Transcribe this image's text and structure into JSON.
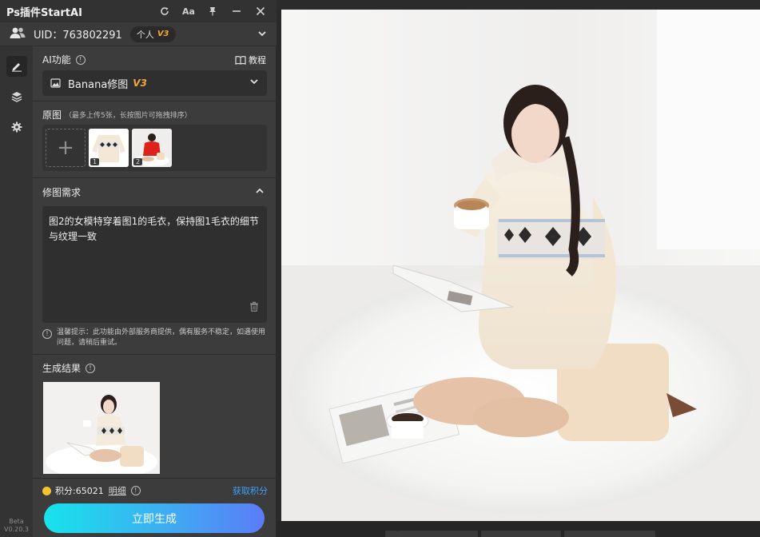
{
  "window": {
    "title": "Ps插件StartAI"
  },
  "user": {
    "uid_label": "UID：763802291",
    "plan_label": "个人",
    "plan_version": "V3"
  },
  "ai_function": {
    "label": "AI功能",
    "tutorial_label": "教程",
    "selected_model": "Banana修图",
    "model_version": "V3"
  },
  "original": {
    "label": "原图",
    "hint": "（最多上传5张，长按图片可拖拽排序）",
    "thumbnails": [
      {
        "index": "1",
        "content": "sweater-on-white"
      },
      {
        "index": "2",
        "content": "woman-in-red"
      }
    ]
  },
  "edit_request": {
    "label": "修图需求",
    "text": "图2的女模特穿着图1的毛衣，保持图1毛衣的细节与纹理一致"
  },
  "notice": {
    "text": "温馨提示：此功能由外部服务商提供，偶有服务不稳定，如遇使用问题，请稍后重试。"
  },
  "result": {
    "label": "生成结果"
  },
  "credits": {
    "label": "积分:65021",
    "detail_label": "明细",
    "get_label": "获取积分"
  },
  "generate_button": {
    "label": "立即生成"
  },
  "version": {
    "line1": "Beta",
    "line2": "V0.20.3"
  },
  "colors": {
    "panel_bg": "#3c3c3c",
    "accent_gold": "#f0a73a",
    "link_blue": "#3ea0ff",
    "button_gradient_start": "#17e3ea",
    "button_gradient_end": "#5b7cf7"
  }
}
